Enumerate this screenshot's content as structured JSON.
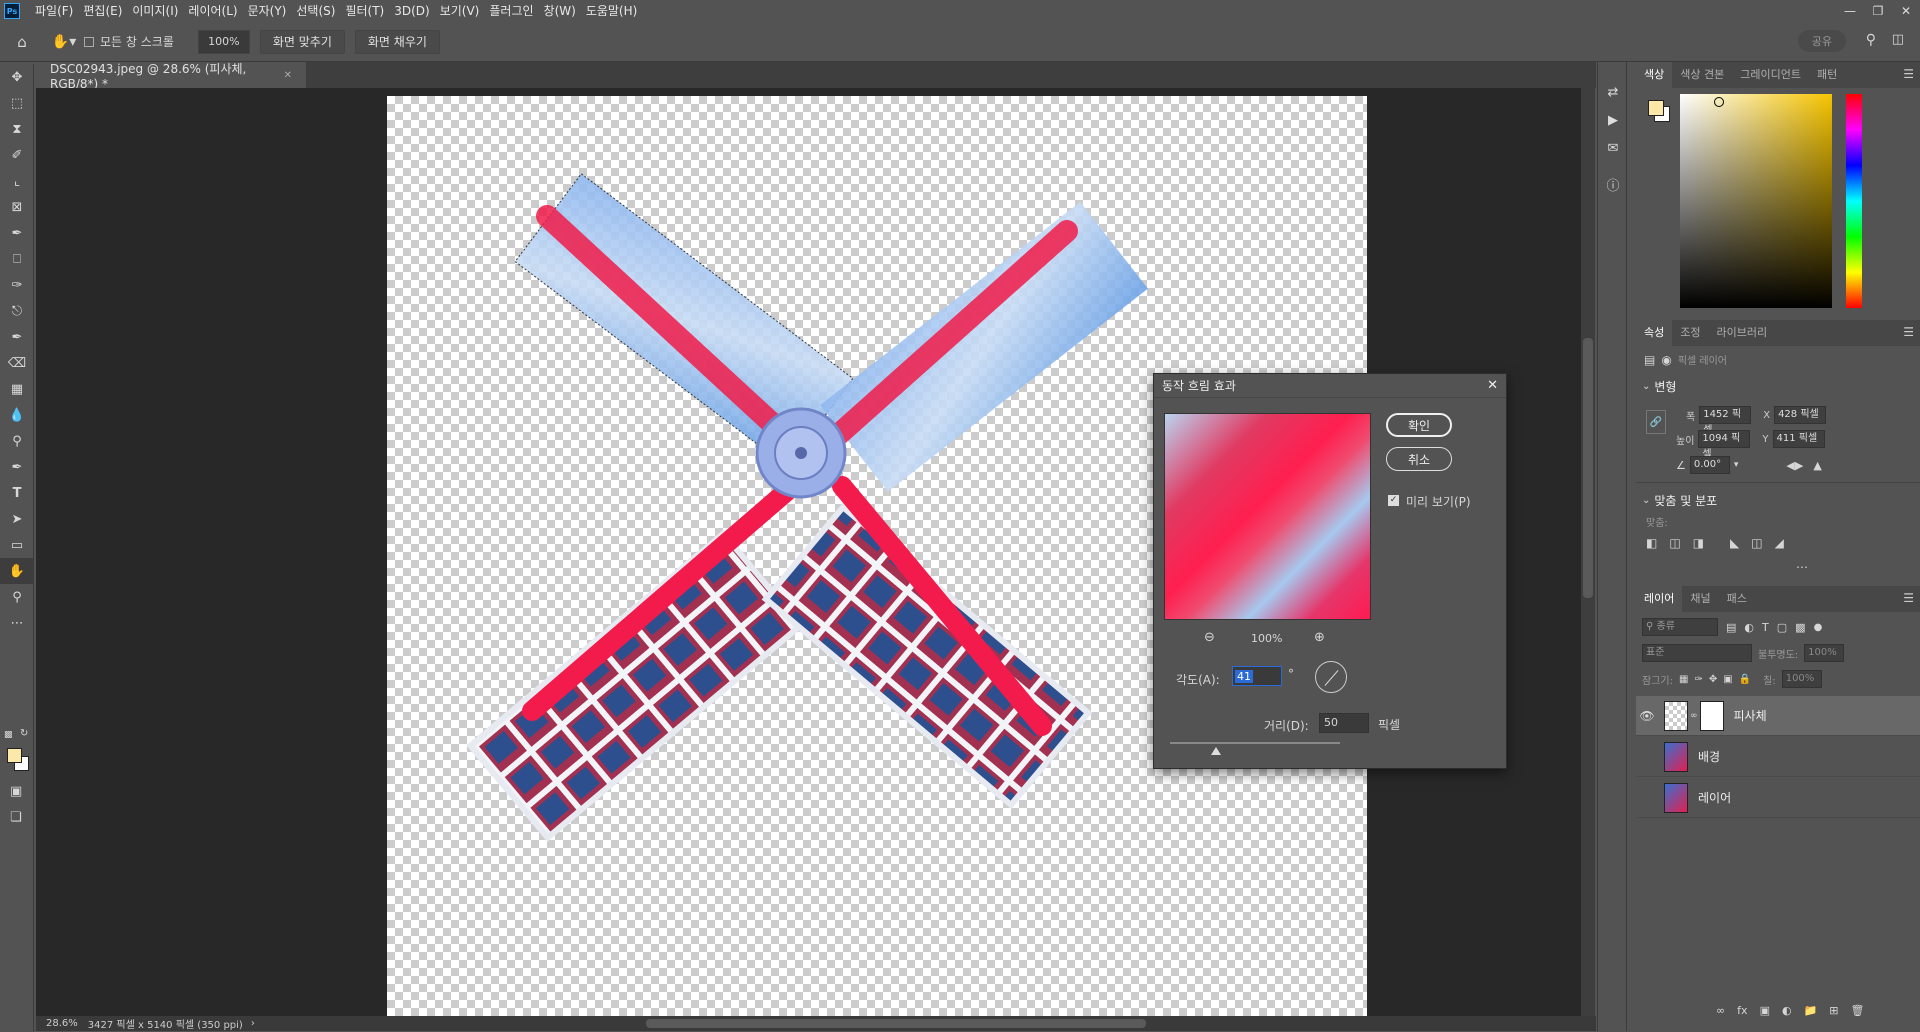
{
  "menubar": {
    "logo": "Ps",
    "items": [
      "파일(F)",
      "편집(E)",
      "이미지(I)",
      "레이어(L)",
      "문자(Y)",
      "선택(S)",
      "필터(T)",
      "3D(D)",
      "보기(V)",
      "플러그인",
      "창(W)",
      "도움말(H)"
    ]
  },
  "options": {
    "scroll_all_label": "모든 창 스크롤",
    "zoom_value": "100%",
    "fit_screen": "화면 맞추기",
    "fill_screen": "화면 채우기",
    "share": "공유"
  },
  "document": {
    "tab_title": "DSC02943.jpeg @ 28.6% (피사체, RGB/8*) *",
    "zoom": "28.6%",
    "size_info": "3427 픽셀 x 5140 픽셀 (350 ppi)"
  },
  "color_panel": {
    "tabs": [
      "색상",
      "색상 견본",
      "그레이디언트",
      "패턴"
    ],
    "fg_color": "#fce8a8"
  },
  "properties_panel": {
    "tabs": [
      "속성",
      "조정",
      "라이브러리"
    ],
    "layer_type": "픽셀 레이어",
    "transform_title": "변형",
    "width_label": "폭",
    "width_value": "1452 픽셀",
    "x_label": "X",
    "x_value": "428 픽셀",
    "height_label": "높이",
    "height_value": "1094 픽셀",
    "y_label": "Y",
    "y_value": "411 픽셀",
    "angle_value": "0.00°",
    "align_title": "맞춤 및 분포",
    "align_label": "맞춤:"
  },
  "layers_panel": {
    "tabs": [
      "레이어",
      "채널",
      "패스"
    ],
    "filter_placeholder": "종류",
    "blend_mode": "표준",
    "opacity_label": "불투명도:",
    "opacity_value": "100%",
    "lock_label": "잠그기:",
    "fill_label": "칠:",
    "fill_value": "100%",
    "layers": [
      {
        "name": "피사체",
        "visible": true,
        "selected": true
      },
      {
        "name": "배경",
        "visible": false,
        "selected": false
      },
      {
        "name": "레이어",
        "visible": false,
        "selected": false
      }
    ]
  },
  "dialog": {
    "title": "동작 흐림 효과",
    "ok": "확인",
    "cancel": "취소",
    "preview_label": "미리 보기(P)",
    "preview_zoom": "100%",
    "angle_label": "각도(A):",
    "angle_value": "41",
    "angle_unit": "°",
    "distance_label": "거리(D):",
    "distance_value": "50",
    "distance_unit": "픽셀"
  }
}
